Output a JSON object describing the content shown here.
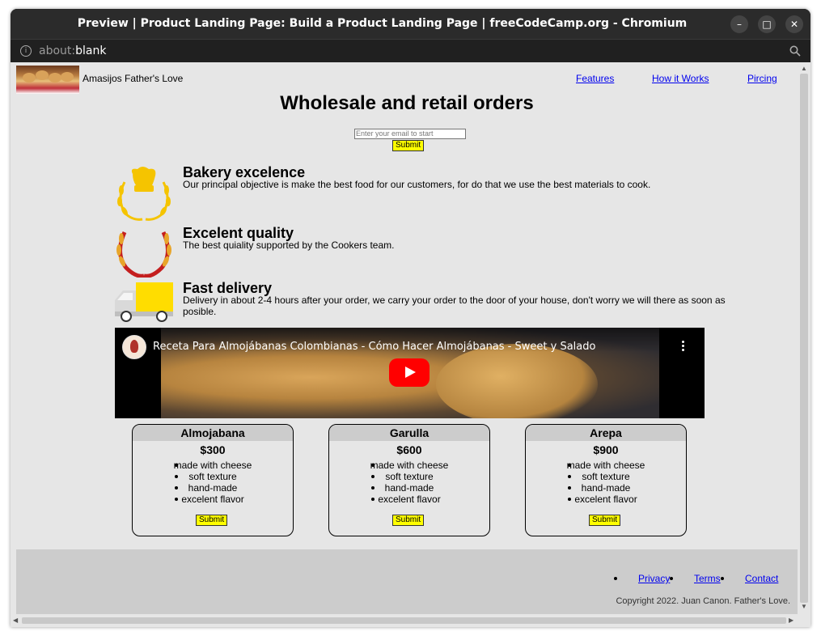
{
  "window": {
    "title": "Preview | Product Landing Page: Build a Product Landing Page | freeCodeCamp.org - Chromium",
    "minimize_glyph": "–",
    "maximize_glyph": "□",
    "close_glyph": "✕"
  },
  "address": {
    "scheme": "about:",
    "path": "blank"
  },
  "header": {
    "brand": "Amasijos Father's Love",
    "nav": [
      "Features",
      "How it Works",
      "Pircing"
    ]
  },
  "hero": {
    "heading": "Wholesale and retail orders",
    "email_placeholder": "Enter your email to start",
    "submit_label": "Submit"
  },
  "features": [
    {
      "icon": "chef-hat-icon",
      "title": "Bakery excelence",
      "description": "Our principal objective is make the best food for our customers, for do that we use the best materials to cook."
    },
    {
      "icon": "laurel-wreath-icon",
      "title": "Excelent quality",
      "description": "The best quiality supported by the Cookers team."
    },
    {
      "icon": "delivery-truck-icon",
      "title": "Fast delivery",
      "description": "Delivery in about 2-4 hours after your order, we carry your order to the door of your house, don't worry we will there as soon as posible."
    }
  ],
  "video": {
    "title": "Receta Para Almojábanas Colombianas - Cómo Hacer Almojábanas - Sweet y Salado"
  },
  "products": [
    {
      "name": "Almojabana",
      "price": "$300",
      "features": [
        "made with cheese",
        "soft texture",
        "hand-made",
        "excelent flavor"
      ],
      "button": "Submit"
    },
    {
      "name": "Garulla",
      "price": "$600",
      "features": [
        "made with cheese",
        "soft texture",
        "hand-made",
        "excelent flavor"
      ],
      "button": "Submit"
    },
    {
      "name": "Arepa",
      "price": "$900",
      "features": [
        "made with cheese",
        "soft texture",
        "hand-made",
        "excelent flavor"
      ],
      "button": "Submit"
    }
  ],
  "footer": {
    "links": [
      "Privacy",
      "Terms",
      "Contact"
    ],
    "copyright": "Copyright 2022. Juan Canon. Father's Love."
  },
  "colors": {
    "accent_yellow": "#ffff00",
    "link_blue": "#0000ee",
    "page_bg": "#e6e6e6",
    "footer_bg": "#cccccc",
    "youtube_red": "#ff0000"
  }
}
